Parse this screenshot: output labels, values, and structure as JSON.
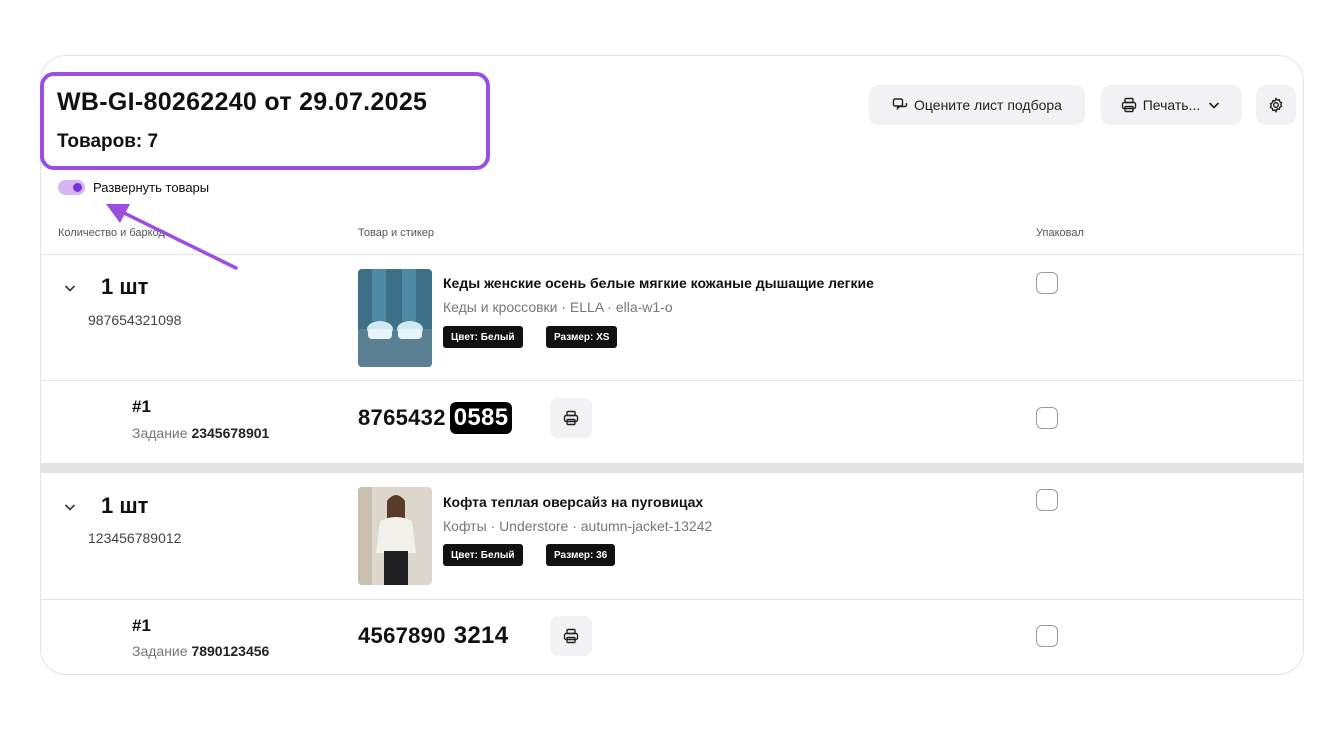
{
  "header": {
    "title": "WB-GI-80262240 от 29.07.2025",
    "items_count": "Товаров: 7",
    "rate_button": "Оцените лист подбора",
    "print_button": "Печать...",
    "accent": "#9b4fe0"
  },
  "toggle": {
    "label": "Развернуть товары",
    "on": true
  },
  "columns": {
    "qty_barcode": "Количество и баркод",
    "product_sticker": "Товар и стикер",
    "packed": "Упаковал"
  },
  "products": [
    {
      "qty": "1 шт",
      "barcode": "987654321098",
      "name": "Кеды женские осень белые мягкие кожаные дышащие легкие",
      "meta": "Кеды и кроссовки · ELLA · ella-w1-o",
      "tag_color": "Цвет: Белый",
      "tag_size": "Размер: XS",
      "task": {
        "hash": "#1",
        "task_label": "Задание",
        "task_number": "2345678901",
        "sticker_prefix": "8765432",
        "sticker_suffix": "0585"
      }
    },
    {
      "qty": "1 шт",
      "barcode": "123456789012",
      "name": "Кофта теплая оверсайз на пуговицах",
      "meta": "Кофты · Understore · autumn-jacket-13242",
      "tag_color": "Цвет: Белый",
      "tag_size": "Размер: 36",
      "task": {
        "hash": "#1",
        "task_label": "Задание",
        "task_number": "7890123456",
        "sticker_prefix": "4567890",
        "sticker_suffix": "3214"
      }
    }
  ]
}
